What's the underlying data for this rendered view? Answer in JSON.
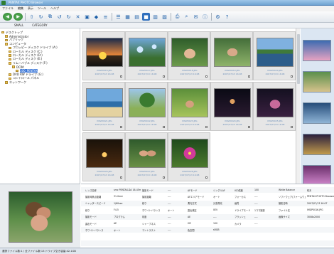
{
  "window": {
    "title": "PENTAX PHOTO Browser"
  },
  "menu": [
    "ファイル",
    "編集",
    "表示",
    "ツール",
    "ヘルプ"
  ],
  "toolbar": {
    "icons": [
      "back-icon",
      "forward-icon",
      "up-folder-icon",
      "refresh-icon",
      "copy-icon",
      "rotate-left-icon",
      "rotate-right-icon",
      "delete-icon",
      "slideshow-icon",
      "view-mode-icon",
      "sort-icon",
      "list-view-icon",
      "thumb-small-icon",
      "thumb-medium-icon",
      "thumb-large-icon",
      "detail-icon",
      "filter-icon",
      "print-icon",
      "search-icon",
      "email-icon",
      "info-icon",
      "settings-icon",
      "help-icon"
    ]
  },
  "tabs": [
    "SMALL",
    "CATEGORY"
  ],
  "tree": [
    {
      "label": "デスクトップ",
      "indent": 0
    },
    {
      "label": "Administrator",
      "indent": 1
    },
    {
      "label": "パブリック",
      "indent": 1
    },
    {
      "label": "コンピュータ",
      "indent": 1
    },
    {
      "label": "フロッピー ディスク ドライブ (A:)",
      "indent": 2
    },
    {
      "label": "ローカル ディスク (C:)",
      "indent": 2
    },
    {
      "label": "ローカル ディスク (D:)",
      "indent": 2
    },
    {
      "label": "ローカル ディスク (E:)",
      "indent": 2
    },
    {
      "label": "リムーバブル ディスク (F:)",
      "indent": 2
    },
    {
      "label": "DCIM",
      "indent": 3
    },
    {
      "label": "100_PENTAX",
      "indent": 4,
      "selected": true
    },
    {
      "label": "DVD RW ドライブ (G:)",
      "indent": 2
    },
    {
      "label": "コントロール パネル",
      "indent": 2
    },
    {
      "label": "ネットワーク",
      "indent": 1
    }
  ],
  "thumbnails": [
    {
      "name": "IMGP0016.JPG",
      "meta": "2007/07/13 16:08",
      "scene": "sunset"
    },
    {
      "name": "IMGP0017.JPG",
      "meta": "2007/07/13 16:08",
      "scene": "bubbles"
    },
    {
      "name": "IMGP0018.JPG",
      "meta": "2007/07/13 16:08",
      "scene": "family"
    },
    {
      "name": "IMGP0019.JPG",
      "meta": "2007/07/13 16:08",
      "scene": "child"
    },
    {
      "name": "IMGP0020.JPG",
      "meta": "2007/07/13 16:08",
      "scene": "lake"
    },
    {
      "name": "IMGP0021.JPG",
      "meta": "2007/07/13 16:08",
      "scene": "beach"
    },
    {
      "name": "IMGP0022.JPG",
      "meta": "2007/07/13 16:08",
      "scene": "tree"
    },
    {
      "name": "IMGP0023.JPG",
      "meta": "2007/07/13 16:08",
      "scene": "field"
    },
    {
      "name": "IMGP0024.JPG",
      "meta": "2007/07/13 16:08",
      "scene": "night"
    },
    {
      "name": "IMGP0025.JPG",
      "meta": "2007/07/13 16:08",
      "scene": "dance"
    },
    {
      "name": "IMGP0026.JPG",
      "meta": "2007/07/13 16:08",
      "scene": "candle"
    },
    {
      "name": "IMGP0027.JPG",
      "meta": "2007/07/13 16:08",
      "scene": "couple"
    },
    {
      "name": "IMGP0028.JPG",
      "meta": "2007/07/13 16:08",
      "scene": "flower"
    }
  ],
  "info": [
    [
      "レンズ名称",
      "smc PENTAX-DA 16-45mm",
      "撮影モード",
      "----",
      "AFモード",
      "シングルAF",
      "ISO感度",
      "100",
      "White Balance",
      "晴天"
    ],
    [
      "撮影時焦点距離",
      "31.0mm",
      "撮影距離",
      "----",
      "AFエリアモード",
      "オート",
      "フォーカス",
      "----",
      "ソフトウェア(ファームウェア)",
      "PENTAX PHOTO Browser Ver"
    ],
    [
      "シャッタースピード",
      "1/60sec",
      "絞り",
      "----",
      "測光方式",
      "分割測光",
      "画質",
      "----",
      "撮影日時",
      "2007/07/13 16:07"
    ],
    [
      "絞り",
      "F4.5",
      "ホワイトバランス",
      "オート",
      "露出補正",
      "0EV",
      "ドライブモード",
      "1コマ撮影",
      "ファイル名",
      "IMGP0016.JPG"
    ],
    [
      "撮影モード",
      "プログラム",
      "彩度",
      "----",
      "AE",
      "----",
      "フラッシュ",
      "----",
      "画像サイズ",
      "3008x2000"
    ],
    [
      "露出モード",
      "AE",
      "シャープネス",
      "----",
      "ISO",
      "100",
      "カメラ",
      "----",
      "",
      ""
    ],
    [
      "ホワイトバランス",
      "オート",
      "コントラスト",
      "----",
      "色空間",
      "sRGB",
      "",
      "",
      "",
      ""
    ],
    [
      "",
      "",
      "",
      "",
      "",
      "",
      "",
      "",
      "",
      ""
    ],
    [
      "",
      "",
      "",
      "",
      "",
      "",
      "",
      "",
      "",
      ""
    ]
  ],
  "status": "選択ファイル数:1 / 全ファイル数:13  ドライブ空き容量:42.1GB"
}
